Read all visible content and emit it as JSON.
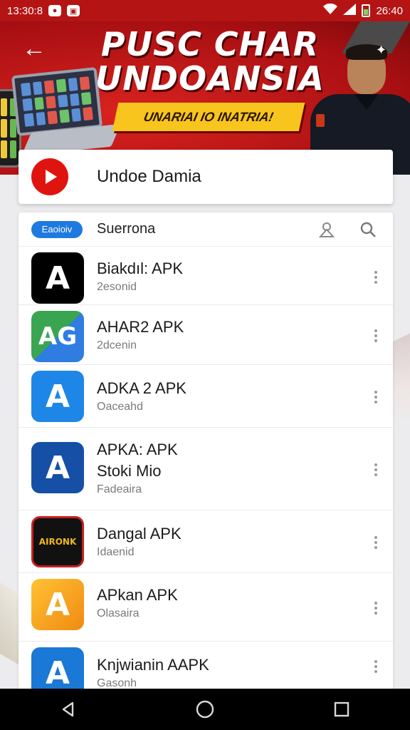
{
  "status_bar": {
    "time": "13:30:8",
    "battery_text": "26:40"
  },
  "banner": {
    "title_line1": "PUSC CHAR",
    "title_line2": "UNDOANSIA",
    "ribbon": "UNARIAI IO INATRIA!"
  },
  "header": {
    "app_title": "Undoe Damia",
    "logo_color": "#e0140f"
  },
  "toolbar": {
    "pill_label": "Eaoioiv",
    "label": "Suerrona",
    "icons": [
      "person-icon",
      "search-icon"
    ]
  },
  "apps": [
    {
      "title": "Biakdıl: APK",
      "subtitle": "2esonid",
      "icon_bg": "#000000",
      "icon_fg": "#ffffff",
      "glyph": "A"
    },
    {
      "title": "AHAR2 APK",
      "subtitle": "2dcenin",
      "icon_bg": "#3aa551",
      "icon_fg": "#ffffff",
      "glyph": "AG"
    },
    {
      "title": "ADKA 2 APK",
      "subtitle": "Oaceahd",
      "icon_bg": "#1e86e6",
      "icon_fg": "#ffffff",
      "glyph": "A"
    },
    {
      "title": "APKA: APK",
      "title2": "Stoki Mio",
      "subtitle": "Fadeaira",
      "icon_bg": "#1650a6",
      "icon_fg": "#ffffff",
      "glyph": "A"
    },
    {
      "title": "Dangal APK",
      "subtitle": "Idaenid",
      "icon_bg": "#111111",
      "icon_fg": "#f0b81a",
      "glyph": "AIRONK"
    },
    {
      "title": "APkan APK",
      "subtitle": "Olasaira",
      "icon_bg": "#f5a623",
      "icon_fg": "#ffffff",
      "glyph": "A"
    },
    {
      "title": "Knjwianin AAPK",
      "subtitle": "Gasonh",
      "icon_bg": "#1a78d6",
      "icon_fg": "#ffffff",
      "glyph": "A"
    }
  ],
  "colors": {
    "banner_red": "#b51414",
    "accent_blue": "#1f7ae0"
  }
}
